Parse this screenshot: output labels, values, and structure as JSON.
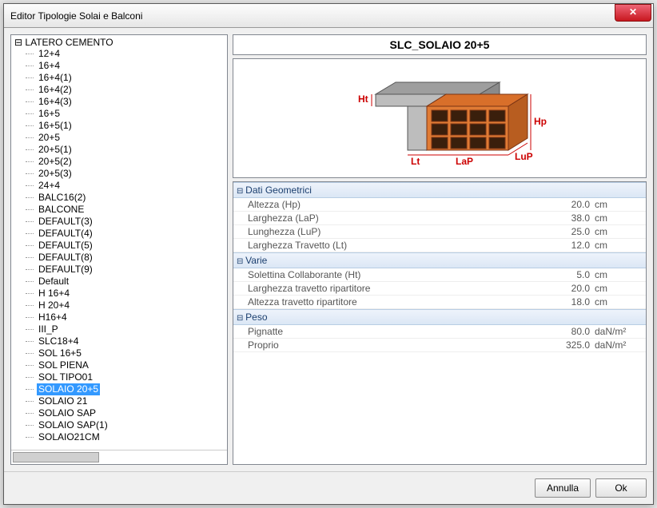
{
  "window": {
    "title": "Editor Tipologie Solai e Balconi"
  },
  "tree": {
    "root_label": "LATERO CEMENTO",
    "items": [
      "12+4",
      "16+4",
      "16+4(1)",
      "16+4(2)",
      "16+4(3)",
      "16+5",
      "16+5(1)",
      "20+5",
      "20+5(1)",
      "20+5(2)",
      "20+5(3)",
      "24+4",
      "BALC16(2)",
      "BALCONE",
      "DEFAULT(3)",
      "DEFAULT(4)",
      "DEFAULT(5)",
      "DEFAULT(8)",
      "DEFAULT(9)",
      "Default",
      "H 16+4",
      "H 20+4",
      "H16+4",
      "III_P",
      "SLC18+4",
      "SOL 16+5",
      "SOL PIENA",
      "SOL TIPO01",
      "SOLAIO 20+5",
      "SOLAIO 21",
      "SOLAIO SAP",
      "SOLAIO SAP(1)",
      "SOLAIO21CM"
    ],
    "selected": "SOLAIO 20+5"
  },
  "detail": {
    "title": "SLC_SOLAIO 20+5",
    "diagram_labels": {
      "ht": "Ht",
      "hp": "Hp",
      "lup": "LuP",
      "lt": "Lt",
      "lap": "LaP"
    },
    "sections": [
      {
        "title": "Dati Geometrici",
        "rows": [
          {
            "label": "Altezza (Hp)",
            "value": "20.0",
            "unit": "cm"
          },
          {
            "label": "Larghezza (LaP)",
            "value": "38.0",
            "unit": "cm"
          },
          {
            "label": "Lunghezza (LuP)",
            "value": "25.0",
            "unit": "cm"
          },
          {
            "label": "Larghezza Travetto (Lt)",
            "value": "12.0",
            "unit": "cm"
          }
        ]
      },
      {
        "title": "Varie",
        "rows": [
          {
            "label": "Solettina Collaborante (Ht)",
            "value": "5.0",
            "unit": "cm"
          },
          {
            "label": "Larghezza travetto ripartitore",
            "value": "20.0",
            "unit": "cm"
          },
          {
            "label": "Altezza travetto ripartitore",
            "value": "18.0",
            "unit": "cm"
          }
        ]
      },
      {
        "title": "Peso",
        "rows": [
          {
            "label": "Pignatte",
            "value": "80.0",
            "unit": "daN/m²"
          },
          {
            "label": "Proprio",
            "value": "325.0",
            "unit": "daN/m²"
          }
        ]
      }
    ]
  },
  "buttons": {
    "cancel": "Annulla",
    "ok": "Ok"
  }
}
